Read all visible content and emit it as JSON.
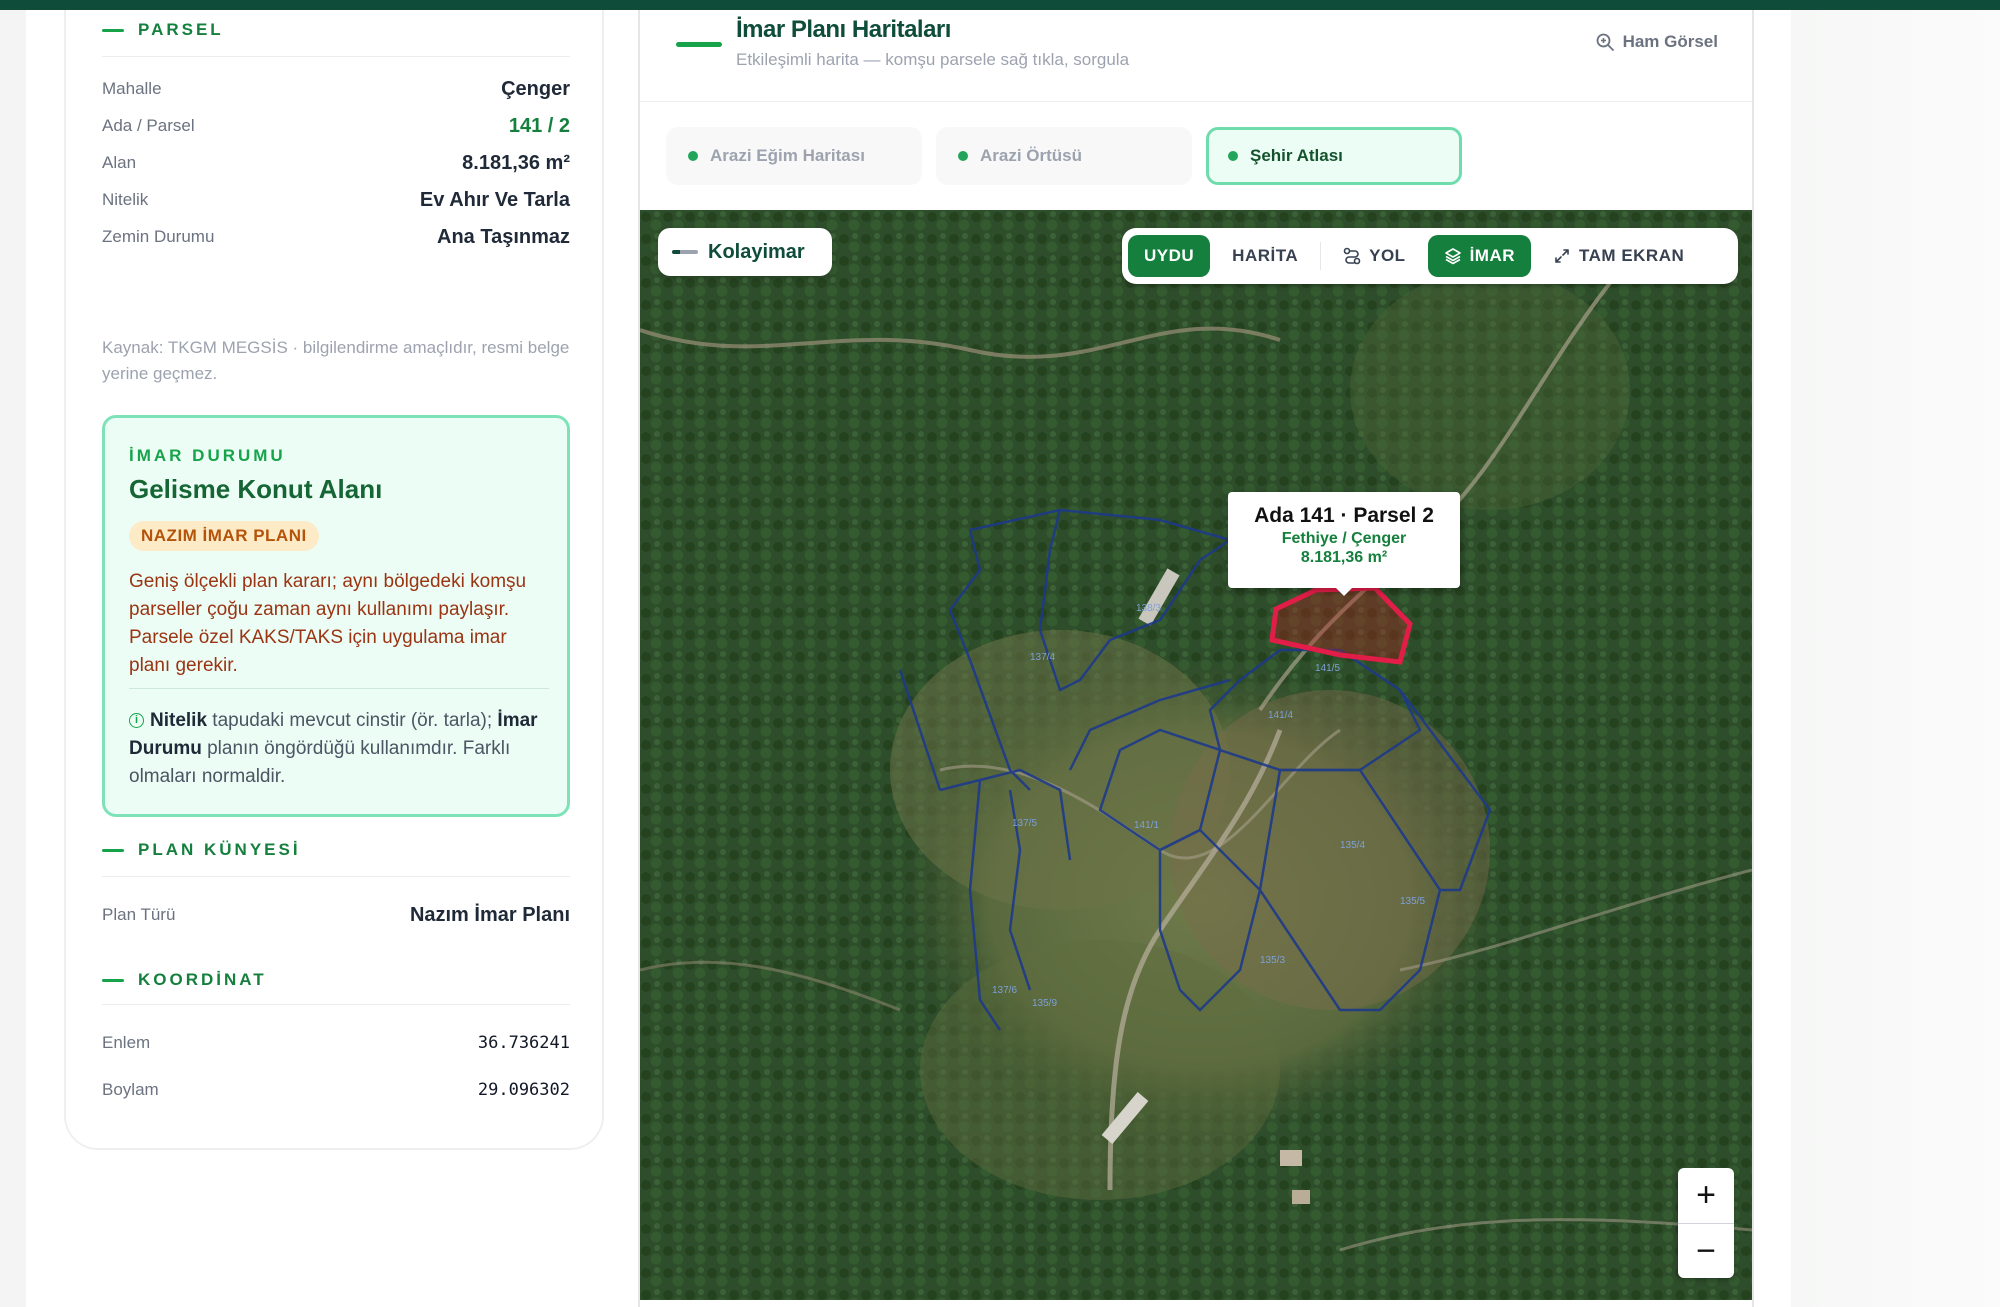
{
  "parcel": {
    "heading": "PARSEL",
    "rows": [
      {
        "key": "Mahalle",
        "value": "Çenger"
      },
      {
        "key": "Ada / Parsel",
        "value": "141 / 2"
      },
      {
        "key": "Alan",
        "value": "8.181,36 m²"
      },
      {
        "key": "Nitelik",
        "value": "Ev Ahır Ve Tarla"
      },
      {
        "key": "Zemin Durumu",
        "value": "Ana Taşınmaz"
      }
    ],
    "source_note": "Kaynak: TKGM MEGSİS · bilgilendirme amaçlıdır, resmi belge yerine geçmez."
  },
  "imar": {
    "eyebrow": "İMAR DURUMU",
    "title": "Gelisme Konut Alanı",
    "badge": "NAZIM İMAR PLANI",
    "description": "Geniş ölçekli plan kararı; aynı bölgedeki komşu parseller çoğu zaman aynı kullanımı paylaşır. Parsele özel KAKS/TAKS için uygulama imar planı gerekir.",
    "note_term1": "Nitelik",
    "note_text1": " tapudaki mevcut cinstir (ör. tarla); ",
    "note_term2": "İmar Durumu",
    "note_text2": " planın öngördüğü kullanımdır. Farklı olmaları normaldir."
  },
  "plan": {
    "heading": "PLAN KÜNYESİ",
    "rows": [
      {
        "key": "Plan Türü",
        "value": "Nazım İmar Planı"
      }
    ]
  },
  "coord": {
    "heading": "KOORDİNAT",
    "rows": [
      {
        "key": "Enlem",
        "value": "36.736241"
      },
      {
        "key": "Boylam",
        "value": "29.096302"
      }
    ]
  },
  "map_panel": {
    "title": "İmar Planı Haritaları",
    "subtitle": "Etkileşimli harita — komşu parsele sağ tıkla, sorgula",
    "raw_button": "Ham Görsel",
    "tabs": [
      {
        "label": "Arazi Eğim Haritası",
        "active": false
      },
      {
        "label": "Arazi Örtüsü",
        "active": false
      },
      {
        "label": "Şehir Atlası",
        "active": true
      }
    ],
    "brand": "Kolayimar",
    "toolbar": {
      "uydu": "UYDU",
      "harita": "HARİTA",
      "yol": "YOL",
      "imar": "İMAR",
      "tam_ekran": "TAM EKRAN"
    },
    "popup": {
      "title": "Ada 141 · Parsel 2",
      "location": "Fethiye / Çenger",
      "area": "8.181,36 m²"
    },
    "parcel_labels": [
      "138/3",
      "137/4",
      "141/5",
      "141/4",
      "137/5",
      "141/1",
      "135/4",
      "135/5",
      "135/3",
      "137/6",
      "135/9"
    ],
    "zoom_in": "+",
    "zoom_out": "−",
    "colors": {
      "accent": "#15803d",
      "selected_parcel": "#e11d48",
      "parcel_lines": "#1e3a8a"
    }
  }
}
